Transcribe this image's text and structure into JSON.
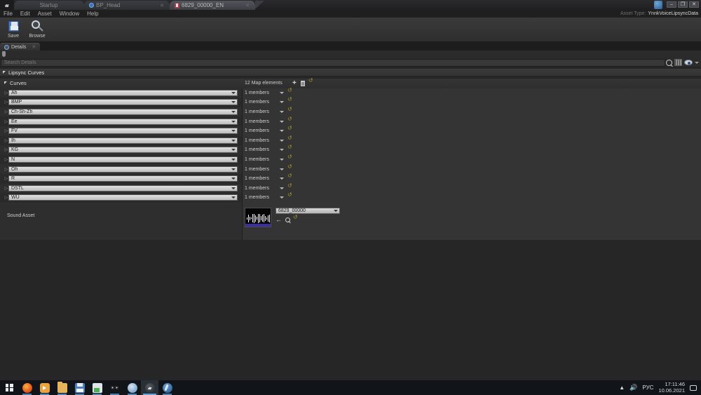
{
  "window": {
    "app_logo": "unreal-logo",
    "tabs": [
      {
        "label": "Startup",
        "icon": "none",
        "active": false,
        "closable": false
      },
      {
        "label": "BP_Head",
        "icon": "blueprint-icon",
        "active": false,
        "closable": true
      },
      {
        "label": "6829_00000_EN",
        "icon": "lipsync-asset-icon",
        "active": true,
        "closable": true
      }
    ],
    "controls": {
      "minimize": "–",
      "maximize": "❐",
      "close": "✕"
    }
  },
  "menubar": {
    "items": [
      "File",
      "Edit",
      "Asset",
      "Window",
      "Help"
    ],
    "asset_type_label": "Asset Type:",
    "asset_type_value": "YnnkVoiceLipsyncData"
  },
  "toolbar": {
    "buttons": [
      {
        "label": "Save",
        "icon": "floppy-disk-icon"
      },
      {
        "label": "Browse",
        "icon": "magnifier-icon"
      }
    ]
  },
  "details_panel": {
    "tab_label": "Details",
    "tab_icon": "magnifier-icon",
    "tab_close": "✕",
    "search": {
      "placeholder": "Search Details",
      "value": ""
    },
    "search_icons": [
      "search-icon",
      "columns-icon",
      "view-options-eye-icon",
      "chevron-down-icon"
    ]
  },
  "categories": {
    "lipsync_curves": "Lipsync Curves"
  },
  "curves_section": {
    "label": "Curves",
    "map_elements_text": "12 Map elements",
    "header_icons": [
      "add-element-icon",
      "delete-all-icon",
      "reset-to-default-icon"
    ],
    "members_text": "1 members",
    "rows": [
      {
        "name": "Ah",
        "members": "1 members"
      },
      {
        "name": "BMP",
        "members": "1 members"
      },
      {
        "name": "Ch-Sh-Zh",
        "members": "1 members"
      },
      {
        "name": "Ee",
        "members": "1 members"
      },
      {
        "name": "FV",
        "members": "1 members"
      },
      {
        "name": "Ih",
        "members": "1 members"
      },
      {
        "name": "KG",
        "members": "1 members"
      },
      {
        "name": "N",
        "members": "1 members"
      },
      {
        "name": "Oh",
        "members": "1 members"
      },
      {
        "name": "R",
        "members": "1 members"
      },
      {
        "name": "DSTL",
        "members": "1 members"
      },
      {
        "name": "WU",
        "members": "1 members"
      }
    ]
  },
  "sound_asset": {
    "label": "Sound Asset",
    "value": "6829_00000",
    "thumbnail": "audio-waveform-thumbnail",
    "buttons": [
      "use-selected-asset-icon",
      "browse-to-asset-icon",
      "reset-to-default-icon"
    ]
  },
  "taskbar": {
    "start": "windows-start-icon",
    "items": [
      {
        "name": "firefox-icon",
        "state": "open"
      },
      {
        "name": "media-player-icon",
        "state": "open"
      },
      {
        "name": "file-explorer-icon",
        "state": "open"
      },
      {
        "name": "save-app-icon",
        "state": "open"
      },
      {
        "name": "notepad-app-icon",
        "state": "open"
      },
      {
        "name": "owl-app-icon",
        "state": "open"
      },
      {
        "name": "blue-app-icon",
        "state": "open"
      },
      {
        "name": "unreal-engine-icon",
        "state": "active"
      },
      {
        "name": "compass-app-icon",
        "state": "open"
      }
    ],
    "tray": {
      "chevron": "▲",
      "volume": "volume-icon",
      "language": "РУС",
      "time": "17:11:46",
      "date": "10.06.2021",
      "notifications": "notification-icon"
    }
  }
}
